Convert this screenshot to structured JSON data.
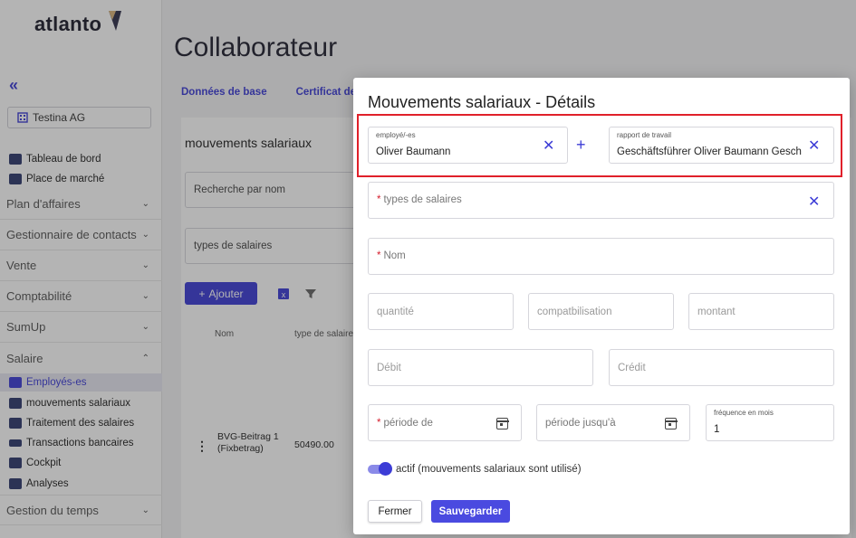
{
  "sidebar": {
    "logo": "atlanto",
    "collapse": "«",
    "company": "Testina AG",
    "top_items": [
      {
        "label": "Tableau de bord",
        "icon": "dashboard-icon"
      },
      {
        "label": "Place de marché",
        "icon": "marketplace-icon"
      }
    ],
    "sections": [
      {
        "label": "Plan d'affaires"
      },
      {
        "label": "Gestionnaire de contacts"
      },
      {
        "label": "Vente"
      },
      {
        "label": "Comptabilité"
      },
      {
        "label": "SumUp"
      },
      {
        "label": "Salaire"
      }
    ],
    "salary_items": [
      {
        "label": "Employés-es",
        "active": true
      },
      {
        "label": "mouvements salariaux"
      },
      {
        "label": "Traitement des salaires"
      },
      {
        "label": "Transactions bancaires"
      },
      {
        "label": "Cockpit"
      },
      {
        "label": "Analyses"
      }
    ],
    "bottom_section": "Gestion du temps"
  },
  "main": {
    "title": "Collaborateur",
    "tabs": [
      "Données de base",
      "Certificat de"
    ],
    "card_title": "mouvements salariaux",
    "search_placeholder": "Recherche par nom",
    "filter_placeholder": "types de salaires",
    "add_button": "Ajouter",
    "columns": [
      "Nom",
      "type de salaire"
    ],
    "row": {
      "name": "BVG-Beitrag 1 (Fixbetrag)",
      "code": "50490.00"
    }
  },
  "modal": {
    "title": "Mouvements salariaux - Détails",
    "employee": {
      "label": "employé/-es",
      "value": "Oliver Baumann"
    },
    "contract": {
      "label": "rapport de travail",
      "value": "Geschäftsführer Oliver Baumann Geschäftsführer"
    },
    "salary_type": "types de salaires",
    "name": "Nom",
    "quantity": "quantité",
    "accounting": "compatbilisation",
    "amount": "montant",
    "debit": "Débit",
    "credit": "Crédit",
    "period_from": "période de",
    "period_to": "période jusqu'à",
    "frequency": {
      "label": "fréquence en mois",
      "value": "1"
    },
    "active_label": "actif (mouvements salariaux sont utilisé)",
    "cancel": "Fermer",
    "save": "Sauvegarder"
  },
  "colors": {
    "accent": "#3c3cd6",
    "highlight": "#e0202a"
  }
}
